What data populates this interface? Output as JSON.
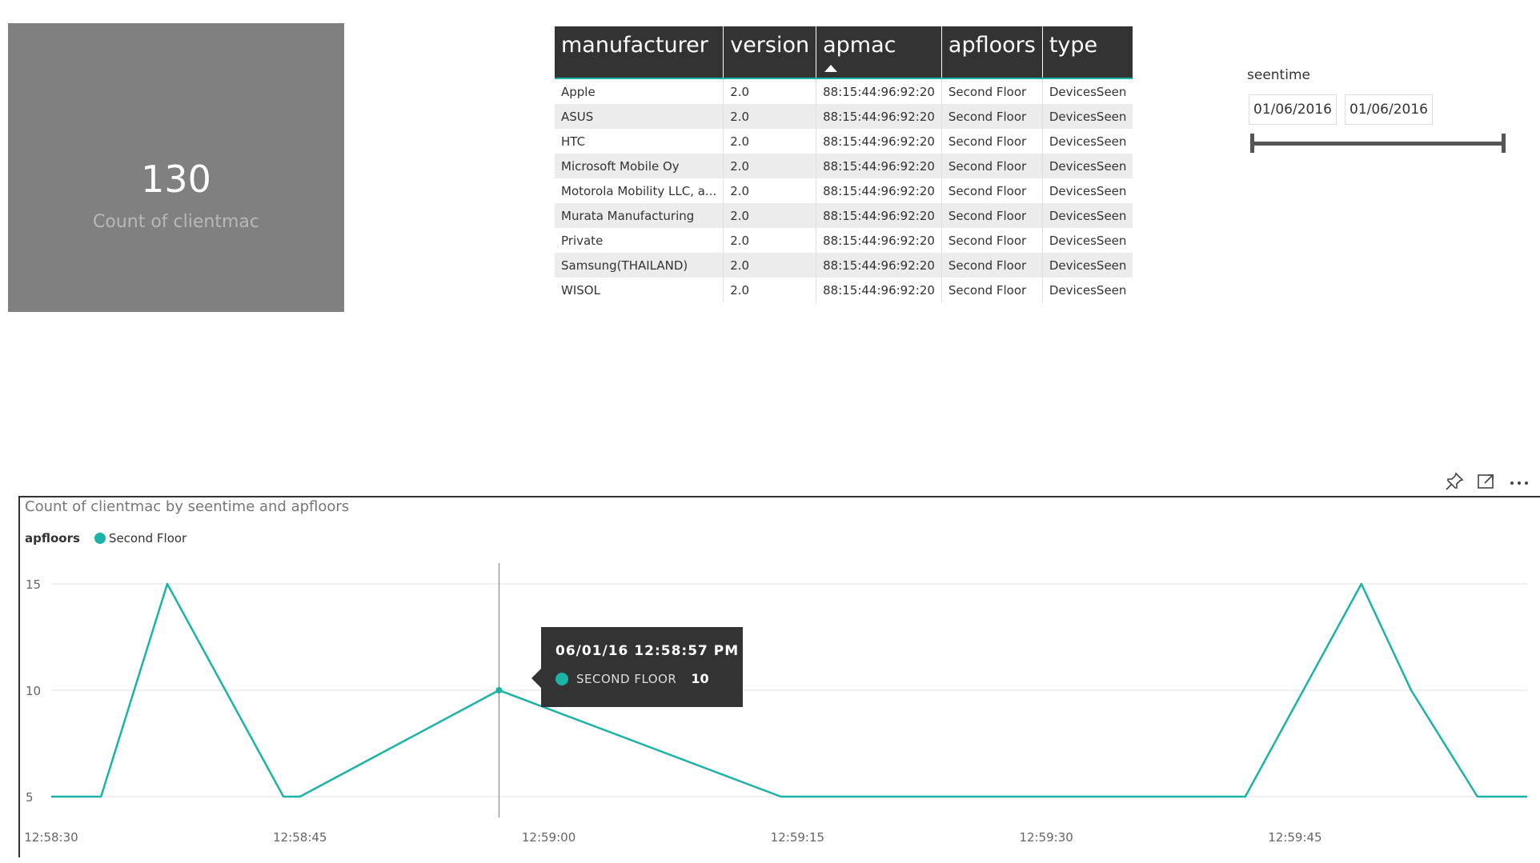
{
  "kpi": {
    "value": "130",
    "label": "Count of clientmac"
  },
  "table": {
    "columns": [
      "manufacturer",
      "version",
      "apmac",
      "apfloors",
      "type"
    ],
    "rows": [
      [
        "Apple",
        "2.0",
        "88:15:44:96:92:20",
        "Second Floor",
        "DevicesSeen"
      ],
      [
        "ASUS",
        "2.0",
        "88:15:44:96:92:20",
        "Second Floor",
        "DevicesSeen"
      ],
      [
        "HTC",
        "2.0",
        "88:15:44:96:92:20",
        "Second Floor",
        "DevicesSeen"
      ],
      [
        "Microsoft Mobile Oy",
        "2.0",
        "88:15:44:96:92:20",
        "Second Floor",
        "DevicesSeen"
      ],
      [
        "Motorola Mobility LLC, a...",
        "2.0",
        "88:15:44:96:92:20",
        "Second Floor",
        "DevicesSeen"
      ],
      [
        "Murata Manufacturing",
        "2.0",
        "88:15:44:96:92:20",
        "Second Floor",
        "DevicesSeen"
      ],
      [
        "Private",
        "2.0",
        "88:15:44:96:92:20",
        "Second Floor",
        "DevicesSeen"
      ],
      [
        "Samsung(THAILAND)",
        "2.0",
        "88:15:44:96:92:20",
        "Second Floor",
        "DevicesSeen"
      ],
      [
        "WISOL",
        "2.0",
        "88:15:44:96:92:20",
        "Second Floor",
        "DevicesSeen"
      ]
    ],
    "sort_column": "apmac",
    "sort_direction": "ascending"
  },
  "slicer": {
    "title": "seentime",
    "start": "01/06/2016",
    "end": "01/06/2016"
  },
  "visual_icons": [
    "pin-icon",
    "focus-mode-icon",
    "more-options-icon"
  ],
  "chart_data": {
    "type": "line",
    "title": "Count of clientmac by seentime and apfloors",
    "legend_title": "apfloors",
    "legend_position": "top-left",
    "grid": true,
    "color": "#1bb3a5",
    "xlabel": "",
    "ylabel": "",
    "x_ticks": [
      "12:58:30",
      "12:58:45",
      "12:59:00",
      "12:59:15",
      "12:59:30",
      "12:59:45"
    ],
    "y_ticks": [
      5,
      10,
      15
    ],
    "ylim": [
      5,
      15
    ],
    "series": [
      {
        "name": "Second Floor",
        "x": [
          "12:58:30",
          "12:58:33",
          "12:58:37",
          "12:58:44",
          "12:58:45",
          "12:58:57",
          "12:59:14",
          "12:59:42",
          "12:59:49",
          "12:59:52",
          "12:59:56",
          "12:59:59"
        ],
        "values": [
          5,
          5,
          15,
          5,
          5,
          10,
          5,
          5,
          15,
          10,
          5,
          5
        ]
      }
    ],
    "hover_x": "12:58:57",
    "tooltip": {
      "header": "06/01/16 12:58:57 PM",
      "series": "SECOND FLOOR",
      "value": "10"
    }
  }
}
